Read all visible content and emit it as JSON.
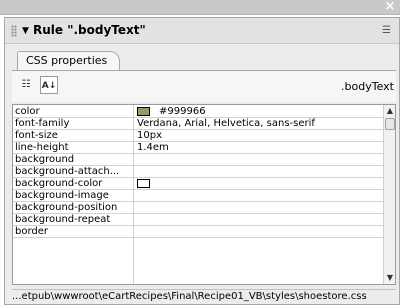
{
  "window": {
    "close_icon": "close-icon"
  },
  "panel": {
    "title": "Rule \".bodyText\"",
    "grip_icon": "grip-icon",
    "collapse_icon": "triangle-down-icon",
    "menu_icon": "panel-options-icon"
  },
  "tab": {
    "label": "CSS properties"
  },
  "toolbar": {
    "category_view_icon": "category-view-icon",
    "alpha_view_icon": "sort-az-icon",
    "selector": ".bodyText"
  },
  "properties": [
    {
      "name": "color",
      "value": "#999966",
      "swatch": "#999966"
    },
    {
      "name": "font-family",
      "value": "Verdana, Arial, Helvetica, sans-serif"
    },
    {
      "name": "font-size",
      "value": "10px"
    },
    {
      "name": "line-height",
      "value": "1.4em"
    },
    {
      "name": "background",
      "value": ""
    },
    {
      "name": "background-attach...",
      "value": ""
    },
    {
      "name": "background-color",
      "value": "",
      "swatch": "#ffffff"
    },
    {
      "name": "background-image",
      "value": ""
    },
    {
      "name": "background-position",
      "value": ""
    },
    {
      "name": "background-repeat",
      "value": ""
    },
    {
      "name": "border",
      "value": ""
    }
  ],
  "status": {
    "path": "...etpub\\wwwroot\\eCartRecipes\\Final\\Recipe01_VB\\styles\\shoestore.css"
  }
}
